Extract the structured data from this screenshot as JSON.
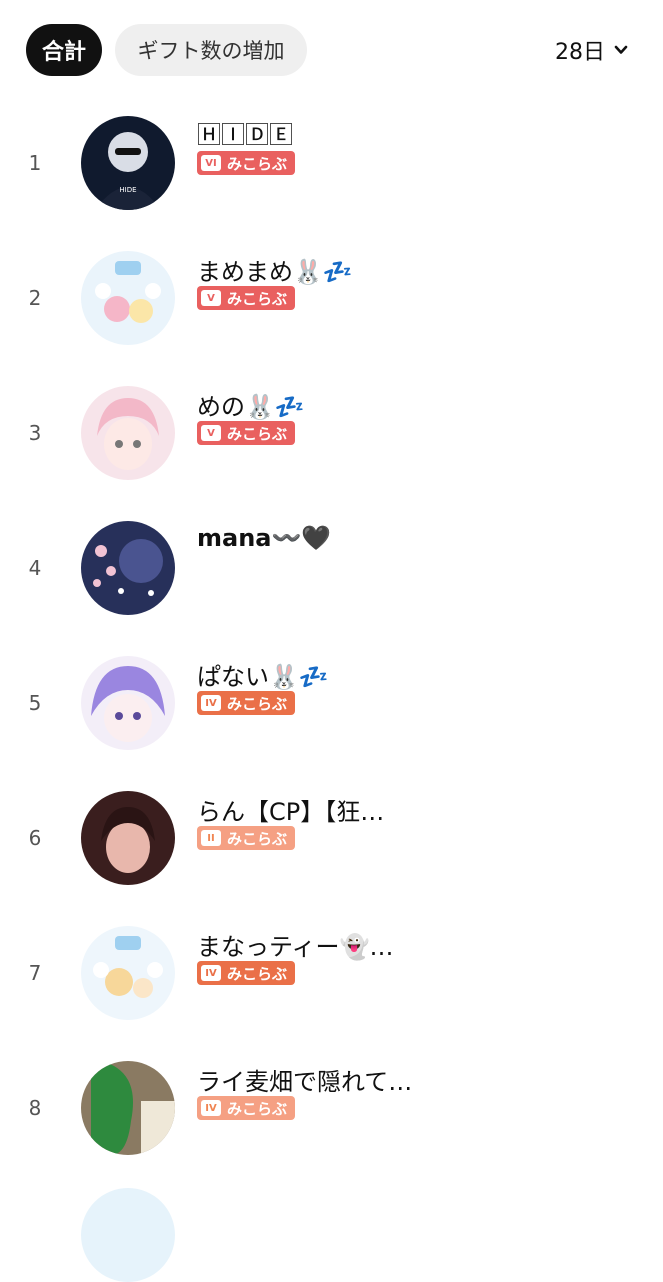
{
  "tabs": {
    "total": "合計",
    "gift": "ギフト数の増加"
  },
  "period": {
    "label": "28日"
  },
  "badge_text": "みこらぶ",
  "rows": [
    {
      "rank": "1",
      "name": "🄷🄸🄳🄴",
      "level": "VI"
    },
    {
      "rank": "2",
      "name": "まめまめ🐰💤",
      "level": "V"
    },
    {
      "rank": "3",
      "name": "めの🐰💤",
      "level": "V"
    },
    {
      "rank": "4",
      "name": "mana〰️🖤"
    },
    {
      "rank": "5",
      "name": "ぱない🐰💤",
      "level": "IV"
    },
    {
      "rank": "6",
      "name": "らん【CP】【狂…",
      "level": "II"
    },
    {
      "rank": "7",
      "name": "まなっティー👻…",
      "level": "IV"
    },
    {
      "rank": "8",
      "name": "ライ麦畑で隠れて…",
      "level": "IV"
    }
  ],
  "colors": {
    "badge_red": "#e9605f",
    "badge_orange": "#ea7048",
    "badge_light": "#f5a083",
    "tab_active": "#111111",
    "tab_inactive": "#efefef"
  }
}
